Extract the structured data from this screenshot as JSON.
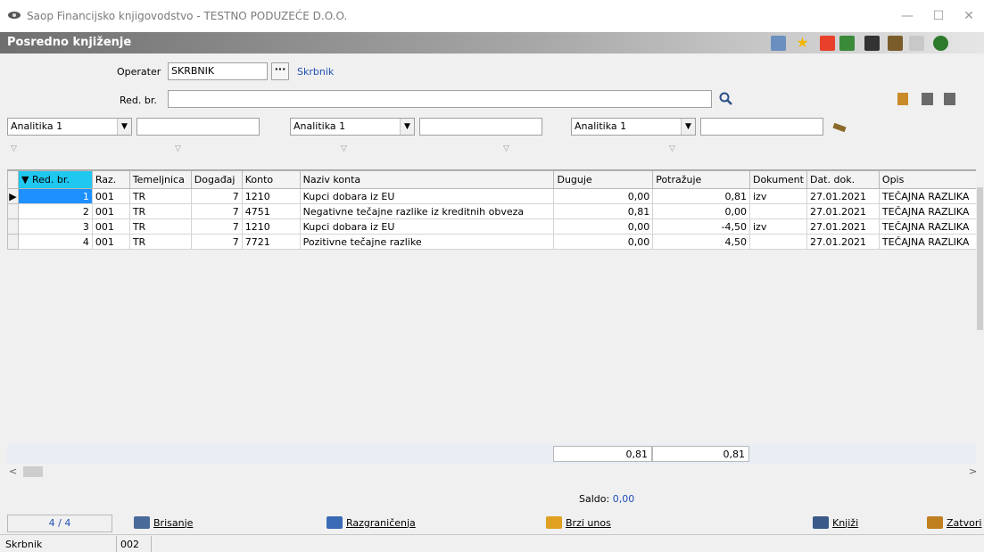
{
  "window": {
    "title": "Saop Financijsko knjigovodstvo - TESTNO PODUZEĆE D.O.O.",
    "minimize": "—",
    "maximize": "☐",
    "close": "✕"
  },
  "form": {
    "title": "Posredno knjiženje"
  },
  "operater": {
    "label": "Operater",
    "value": "SKRBNIK",
    "name": "Skrbnik",
    "ellipsis": "···"
  },
  "redbr": {
    "label": "Red. br.",
    "value": ""
  },
  "analitika": [
    {
      "value": "Analitika 1",
      "text": ""
    },
    {
      "value": "Analitika 1",
      "text": ""
    },
    {
      "value": "Analitika 1",
      "text": ""
    }
  ],
  "columns": [
    "Red. br.",
    "Raz.",
    "Temeljnica",
    "Događaj",
    "Konto",
    "Naziv konta",
    "Duguje",
    "Potražuje",
    "Dokument",
    "Dat. dok.",
    "Opis"
  ],
  "rows": [
    {
      "redbr": "1",
      "raz": "001",
      "temeljnica": "TR",
      "dogadaj": "7",
      "konto": "1210",
      "naziv": "Kupci dobara iz EU",
      "duguje": "0,00",
      "potrazuje": "0,81",
      "dokument": "izv",
      "datum": "27.01.2021",
      "opis": "TEČAJNA RAZLIKA"
    },
    {
      "redbr": "2",
      "raz": "001",
      "temeljnica": "TR",
      "dogadaj": "7",
      "konto": "4751",
      "naziv": "Negativne tečajne razlike iz kreditnih obveza",
      "duguje": "0,81",
      "potrazuje": "0,00",
      "dokument": "",
      "datum": "27.01.2021",
      "opis": "TEČAJNA RAZLIKA"
    },
    {
      "redbr": "3",
      "raz": "001",
      "temeljnica": "TR",
      "dogadaj": "7",
      "konto": "1210",
      "naziv": "Kupci dobara iz EU",
      "duguje": "0,00",
      "potrazuje": "-4,50",
      "dokument": "izv",
      "datum": "27.01.2021",
      "opis": "TEČAJNA RAZLIKA"
    },
    {
      "redbr": "4",
      "raz": "001",
      "temeljnica": "TR",
      "dogadaj": "7",
      "konto": "7721",
      "naziv": "Pozitivne tečajne razlike",
      "duguje": "0,00",
      "potrazuje": "4,50",
      "dokument": "",
      "datum": "27.01.2021",
      "opis": "TEČAJNA RAZLIKA"
    }
  ],
  "totals": {
    "duguje": "0,81",
    "potrazuje": "0,81"
  },
  "saldo": {
    "label": "Saldo:",
    "value": "0,00"
  },
  "record_position": "4 / 4",
  "buttons": {
    "brisanje": "Brisanje",
    "razgranicenja": "Razgraničenja",
    "brzi_unos": "Brzi unos",
    "knjizi": "Knjiži",
    "zatvori": "Zatvori"
  },
  "status": {
    "user": "Skrbnik",
    "code": "002"
  },
  "scroll": {
    "left": "<",
    "right": ">"
  },
  "colors": {
    "header_sort": "#1ec8f0",
    "selected_cell": "#1e90ff",
    "saldo_value": "#1f4fb5",
    "link": "#1f4fb5"
  }
}
